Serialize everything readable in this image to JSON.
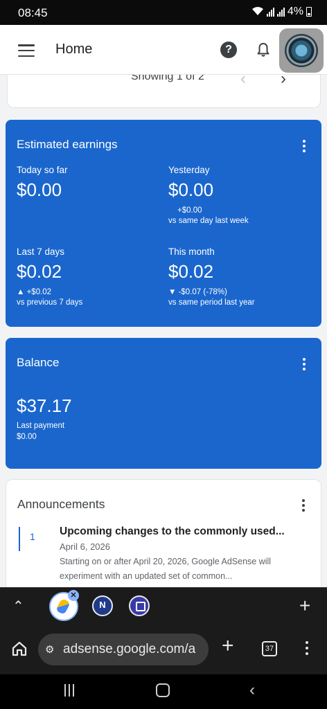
{
  "status_bar": {
    "time": "08:45",
    "battery": "4%"
  },
  "app_bar": {
    "title": "Home",
    "help_glyph": "?"
  },
  "partial_card": {
    "showing": "Showing 1 of 2",
    "prev": "‹",
    "next": "›"
  },
  "earnings": {
    "title": "Estimated earnings",
    "today": {
      "label": "Today so far",
      "value": "$0.00"
    },
    "yesterday": {
      "label": "Yesterday",
      "value": "$0.00",
      "delta": "+$0.00",
      "comparison": "vs same day last week"
    },
    "last7": {
      "label": "Last 7 days",
      "value": "$0.02",
      "delta": "▲ +$0.02",
      "comparison": "vs previous 7 days"
    },
    "month": {
      "label": "This month",
      "value": "$0.02",
      "delta": "▼ -$0.07 (-78%)",
      "comparison": "vs same period last year"
    }
  },
  "balance": {
    "title": "Balance",
    "value": "$37.17",
    "last_payment_label": "Last payment",
    "last_payment_value": "$0.00"
  },
  "announcements": {
    "title": "Announcements",
    "items": [
      {
        "number": "1",
        "headline": "Upcoming changes to the commonly used...",
        "date": "April 6, 2026",
        "body": "Starting on or after April 20, 2026, Google AdSense will experiment with an updated set of common..."
      }
    ]
  },
  "browser": {
    "url": "adsense.google.com/a",
    "tab_count": "37",
    "tab_close_glyph": "✕",
    "icons": {
      "home": "home-icon",
      "site_settings": "tune-icon",
      "new_tab": "plus-icon",
      "tabs": "tab-switcher-icon",
      "menu": "more-vert-icon"
    }
  },
  "colors": {
    "card_blue": "#1a66cd",
    "page_bg": "#f1f3f4",
    "browser_bg": "#1b1b1b"
  }
}
